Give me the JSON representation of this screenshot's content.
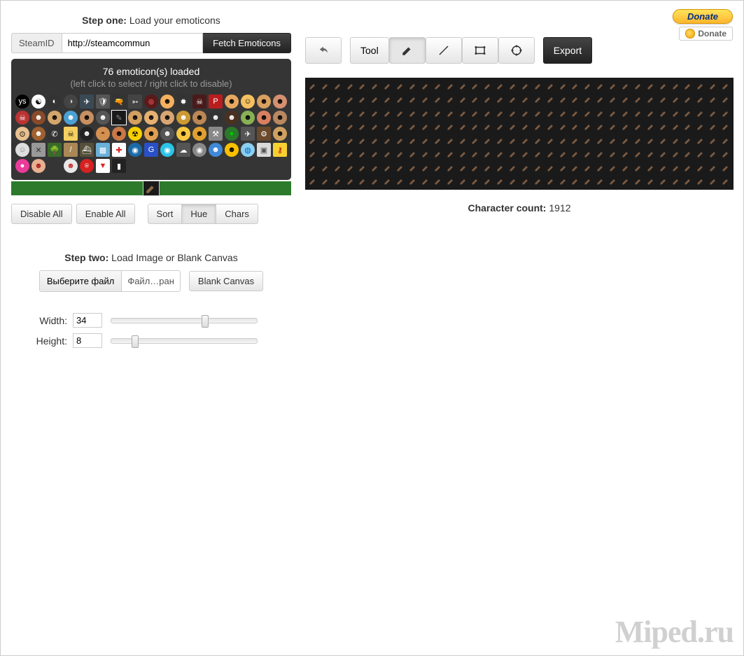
{
  "donate": {
    "main": "Donate",
    "small": "Donate"
  },
  "step1": {
    "label_bold": "Step one:",
    "label_rest": " Load your emoticons",
    "addon": "SteamID",
    "url": "http://steamcommun",
    "fetch": "Fetch Emoticons",
    "count_text": "76 emoticon(s) loaded",
    "hint": "(left click to select / right click to disable)",
    "emoticons": [
      {
        "bg": "#000",
        "fg": "#fff",
        "t": "ys",
        "s": 0
      },
      {
        "bg": "#fff",
        "fg": "#000",
        "t": "☯",
        "s": 0
      },
      {
        "bg": "#333",
        "fg": "#fff",
        "t": "◐",
        "s": 0
      },
      {
        "bg": "#444",
        "fg": "#ccc",
        "t": "◑",
        "s": 0
      },
      {
        "bg": "#3a4a55",
        "fg": "#fff",
        "t": "✈",
        "s": 1
      },
      {
        "bg": "#555",
        "fg": "#fff",
        "t": "🛡",
        "s": 1
      },
      {
        "bg": "#333",
        "fg": "#fff",
        "t": "🔫",
        "s": 1
      },
      {
        "bg": "#444",
        "fg": "#fff",
        "t": "➳",
        "s": 1
      },
      {
        "bg": "#5a1a1a",
        "fg": "#f55",
        "t": "⊛",
        "s": 0
      },
      {
        "bg": "#f5b060",
        "fg": "#000",
        "t": "☻",
        "s": 0
      },
      {
        "bg": "#333",
        "fg": "#fff",
        "t": "✹",
        "s": 1
      },
      {
        "bg": "#4a1a1a",
        "fg": "#fff",
        "t": "☠",
        "s": 1
      },
      {
        "bg": "#b91d1d",
        "fg": "#fff",
        "t": "P",
        "s": 1
      },
      {
        "bg": "#e6a860",
        "fg": "#000",
        "t": "☻",
        "s": 0
      },
      {
        "bg": "#f5c060",
        "fg": "#000",
        "t": "☺",
        "s": 0
      },
      {
        "bg": "#d9a060",
        "fg": "#000",
        "t": "☻",
        "s": 0
      },
      {
        "bg": "#d49070",
        "fg": "#000",
        "t": "☻",
        "s": 0
      },
      {
        "bg": "#b33",
        "fg": "#fff",
        "t": "☠",
        "s": 0
      },
      {
        "bg": "#8a4a2a",
        "fg": "#fff",
        "t": "☻",
        "s": 0
      },
      {
        "bg": "#d4a66a",
        "fg": "#000",
        "t": "☻",
        "s": 0
      },
      {
        "bg": "#4aa0d4",
        "fg": "#fff",
        "t": "☻",
        "s": 0
      },
      {
        "bg": "#c89060",
        "fg": "#000",
        "t": "☻",
        "s": 0
      },
      {
        "bg": "#555",
        "fg": "#fff",
        "t": "☻",
        "s": 0
      },
      {
        "bg": "#1a1a1a",
        "fg": "#888",
        "t": "✎",
        "s": 1,
        "sel": 1
      },
      {
        "bg": "#d4a060",
        "fg": "#000",
        "t": "☻",
        "s": 0
      },
      {
        "bg": "#e6b070",
        "fg": "#000",
        "t": "☻",
        "s": 0
      },
      {
        "bg": "#d9a572",
        "fg": "#000",
        "t": "☻",
        "s": 0
      },
      {
        "bg": "#c93",
        "fg": "#fff",
        "t": "☻",
        "s": 0
      },
      {
        "bg": "#bb8855",
        "fg": "#000",
        "t": "☻",
        "s": 0
      },
      {
        "bg": "#333",
        "fg": "#fff",
        "t": "☻",
        "s": 0
      },
      {
        "bg": "#4a3020",
        "fg": "#fff",
        "t": "☻",
        "s": 0
      },
      {
        "bg": "#88b055",
        "fg": "#000",
        "t": "☻",
        "s": 0
      },
      {
        "bg": "#d98060",
        "fg": "#000",
        "t": "☻",
        "s": 0
      },
      {
        "bg": "#b98860",
        "fg": "#000",
        "t": "☻",
        "s": 0
      },
      {
        "bg": "#e8c090",
        "fg": "#000",
        "t": "⊙",
        "s": 0
      },
      {
        "bg": "#a06030",
        "fg": "#fff",
        "t": "☻",
        "s": 0
      },
      {
        "bg": "#333",
        "fg": "#fff",
        "t": "✆",
        "s": 1
      },
      {
        "bg": "#f5d060",
        "fg": "#000",
        "t": "☠",
        "s": 1
      },
      {
        "bg": "#222",
        "fg": "#fff",
        "t": "☻",
        "s": 0
      },
      {
        "bg": "#d49050",
        "fg": "#630",
        "t": "◓",
        "s": 0
      },
      {
        "bg": "#c97846",
        "fg": "#000",
        "t": "☻",
        "s": 0
      },
      {
        "bg": "#f8d000",
        "fg": "#000",
        "t": "☢",
        "s": 0
      },
      {
        "bg": "#e0a050",
        "fg": "#000",
        "t": "☻",
        "s": 0
      },
      {
        "bg": "#555",
        "fg": "#fff",
        "t": "☻",
        "s": 0
      },
      {
        "bg": "#f8c840",
        "fg": "#000",
        "t": "☻",
        "s": 0
      },
      {
        "bg": "#e0a030",
        "fg": "#000",
        "t": "☻",
        "s": 0
      },
      {
        "bg": "#888",
        "fg": "#fff",
        "t": "⚒",
        "s": 1
      },
      {
        "bg": "#2a7a2a",
        "fg": "#0c0",
        "t": "●",
        "s": 0
      },
      {
        "bg": "#555",
        "fg": "#fff",
        "t": "✈",
        "s": 1
      },
      {
        "bg": "#6a4a2a",
        "fg": "#fff",
        "t": "⚙",
        "s": 1
      },
      {
        "bg": "#d0a060",
        "fg": "#000",
        "t": "☻",
        "s": 0
      },
      {
        "bg": "#dedede",
        "fg": "#888",
        "t": "☺",
        "s": 0
      },
      {
        "bg": "#999",
        "fg": "#333",
        "t": "✕",
        "s": 1
      },
      {
        "bg": "#3a6a2a",
        "fg": "#9c4",
        "t": "🌳",
        "s": 1
      },
      {
        "bg": "#aa8855",
        "fg": "#fff",
        "t": "/",
        "s": 1
      },
      {
        "bg": "#55503a",
        "fg": "#fff",
        "t": "⛴",
        "s": 1
      },
      {
        "bg": "#6ab0d8",
        "fg": "#fff",
        "t": "▦",
        "s": 1
      },
      {
        "bg": "#fff",
        "fg": "#d22",
        "t": "✚",
        "s": 1
      },
      {
        "bg": "#1a6aa8",
        "fg": "#fff",
        "t": "◉",
        "s": 0
      },
      {
        "bg": "#2a50c8",
        "fg": "#fff",
        "t": "G",
        "s": 1
      },
      {
        "bg": "#2ac4e8",
        "fg": "#fff",
        "t": "◉",
        "s": 0
      },
      {
        "bg": "#555",
        "fg": "#fff",
        "t": "☁",
        "s": 1
      },
      {
        "bg": "#888",
        "fg": "#fff",
        "t": "◉",
        "s": 0
      },
      {
        "bg": "#4088d8",
        "fg": "#fff",
        "t": "☻",
        "s": 0
      },
      {
        "bg": "#f8c000",
        "fg": "#000",
        "t": "☻",
        "s": 0
      },
      {
        "bg": "#8ad0f0",
        "fg": "#06c",
        "t": "◍",
        "s": 0
      },
      {
        "bg": "#dadada",
        "fg": "#555",
        "t": "▣",
        "s": 1
      },
      {
        "bg": "#f8d030",
        "fg": "#a00",
        "t": "⚷",
        "s": 1
      },
      {
        "bg": "#ea3a9a",
        "fg": "#fff",
        "t": "●",
        "s": 0
      },
      {
        "bg": "#e8b090",
        "fg": "#a22",
        "t": "☻",
        "s": 0
      },
      {
        "bg": "#f8",
        "fg": "#fff",
        "t": "",
        "s": 0
      },
      {
        "bg": "#e8e8e8",
        "fg": "#c33",
        "t": "☻",
        "s": 0
      },
      {
        "bg": "#d82020",
        "fg": "#fff",
        "t": "⍟",
        "s": 0
      },
      {
        "bg": "#fff",
        "fg": "#d22",
        "t": "▼",
        "s": 1
      },
      {
        "bg": "#222",
        "fg": "#fff",
        "t": "▮",
        "s": 1
      }
    ],
    "disable_all": "Disable All",
    "enable_all": "Enable All",
    "sort": "Sort",
    "hue": "Hue",
    "chars": "Chars"
  },
  "step2": {
    "label_bold": "Step two:",
    "label_rest": " Load Image or Blank Canvas",
    "choose_file": "Выберите файл",
    "file_status": "Файл…ран",
    "blank_canvas": "Blank Canvas",
    "width_label": "Width:",
    "width_value": "34",
    "height_label": "Height:",
    "height_value": "8"
  },
  "toolbar": {
    "tool_label": "Tool",
    "export": "Export"
  },
  "char_count": {
    "label": "Character count:",
    "value": "1912"
  },
  "canvas": {
    "cols": 34,
    "rows": 8
  },
  "watermark": "Miped.ru"
}
